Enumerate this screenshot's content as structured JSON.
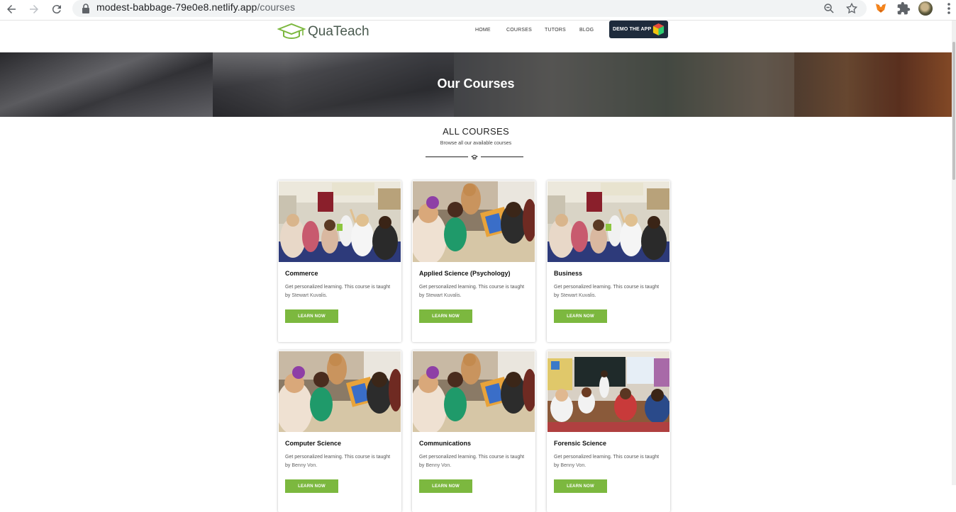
{
  "browser": {
    "url_host": "modest-babbage-79e0e8.netlify.app",
    "url_path": "/courses"
  },
  "site": {
    "logo_text": "QuaTeach",
    "nav": [
      "HOME",
      "COURSES",
      "TUTORS",
      "BLOG"
    ],
    "demo_button": "DEMO THE APP"
  },
  "hero": {
    "title": "Our Courses"
  },
  "section": {
    "title": "ALL COURSES",
    "subtitle": "Browse all our available courses"
  },
  "courses": [
    {
      "title": "Commerce",
      "desc": "Get personalized learning. This course is taught by",
      "tutor": "Stewart Kuvalis.",
      "button": "LEARN NOW",
      "image": "classroom-hands-raised"
    },
    {
      "title": "Applied Science (Psychology)",
      "desc": "Get personalized learning. This course is taught by",
      "tutor": "Stewart Kuvalis.",
      "button": "LEARN NOW",
      "image": "children-reading-book"
    },
    {
      "title": "Business",
      "desc": "Get personalized learning. This course is taught by",
      "tutor": "Stewart Kuvalis.",
      "button": "LEARN NOW",
      "image": "classroom-hands-raised"
    },
    {
      "title": "Computer Science",
      "desc": "Get personalized learning. This course is taught by",
      "tutor": "Benny Von.",
      "button": "LEARN NOW",
      "image": "children-reading-book"
    },
    {
      "title": "Communications",
      "desc": "Get personalized learning. This course is taught by",
      "tutor": "Benny Von.",
      "button": "LEARN NOW",
      "image": "children-reading-book"
    },
    {
      "title": "Forensic Science",
      "desc": "Get personalized learning. This course is taught by",
      "tutor": "Benny Von.",
      "button": "LEARN NOW",
      "image": "teacher-at-blackboard"
    }
  ],
  "colors": {
    "accent": "#7cb83f",
    "demo_bg": "#1e2b3c"
  }
}
